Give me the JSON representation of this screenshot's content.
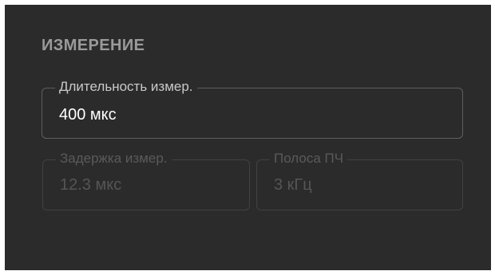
{
  "measurement": {
    "section_title": "ИЗМЕРЕНИЕ",
    "duration": {
      "label": "Длительность измер.",
      "value": "400 мкс"
    },
    "delay": {
      "label": "Задержка измер.",
      "value": "12.3 мкс"
    },
    "bandwidth": {
      "label": "Полоса ПЧ",
      "value": "3 кГц"
    }
  }
}
